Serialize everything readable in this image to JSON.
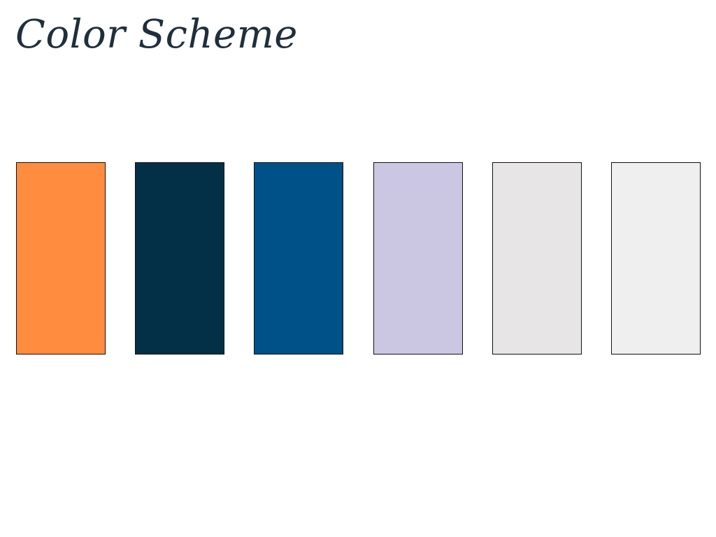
{
  "page": {
    "title": "Color Scheme",
    "title_color": "#1f2f3c"
  },
  "swatches": [
    {
      "color": "#ff8c3f"
    },
    {
      "color": "#033047"
    },
    {
      "color": "#005187"
    },
    {
      "color": "#cbc6e2"
    },
    {
      "color": "#e7e5e6"
    },
    {
      "color": "#efefef"
    }
  ]
}
